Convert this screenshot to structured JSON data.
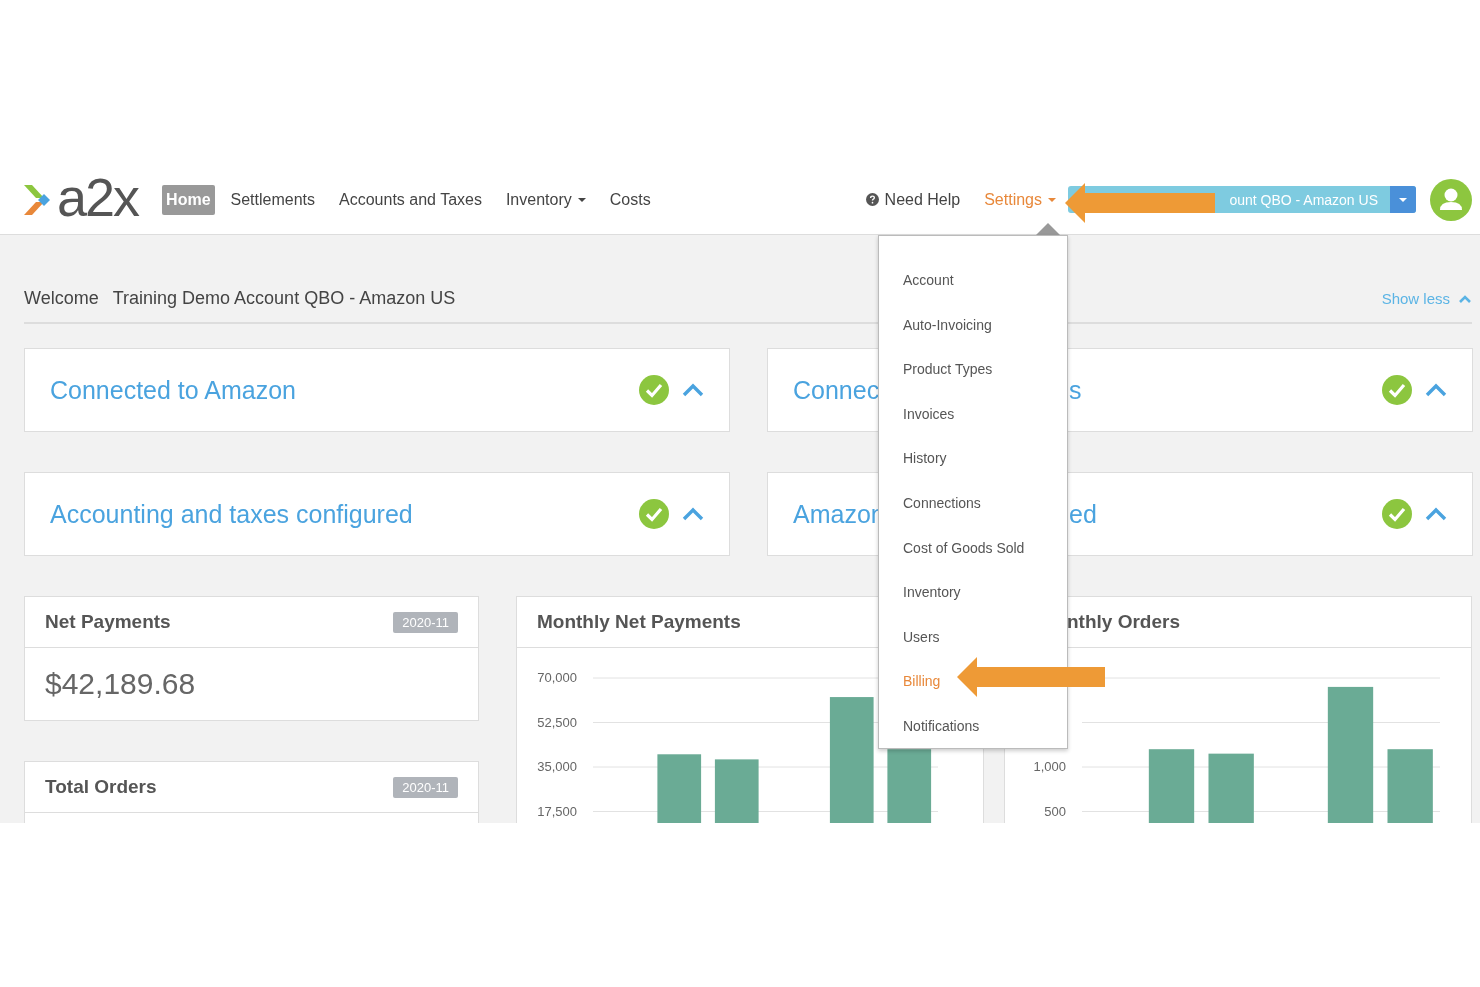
{
  "logo": {
    "text": "a2x"
  },
  "nav": [
    {
      "label": "Home",
      "selected": true,
      "dropdown": false
    },
    {
      "label": "Settlements",
      "selected": false,
      "dropdown": false
    },
    {
      "label": "Accounts and Taxes",
      "selected": false,
      "dropdown": false
    },
    {
      "label": "Inventory",
      "selected": false,
      "dropdown": true
    },
    {
      "label": "Costs",
      "selected": false,
      "dropdown": false
    }
  ],
  "help": {
    "label": "Need Help"
  },
  "settings": {
    "label": "Settings",
    "open": true
  },
  "account_switcher": {
    "label": "ount QBO - Amazon US"
  },
  "welcome": {
    "label": "Welcome",
    "account": "Training Demo Account QBO - Amazon US",
    "toggle": "Show less"
  },
  "status_cards": [
    {
      "title": "Connected to Amazon",
      "done": true,
      "expanded": true
    },
    {
      "title": "Connec",
      "title_after_menu": "s",
      "done": true,
      "expanded": true
    },
    {
      "title": "Accounting and taxes configured",
      "done": true,
      "expanded": true
    },
    {
      "title": "Amazon",
      "title_after_menu": "ed",
      "done": true,
      "expanded": true
    }
  ],
  "stats": [
    {
      "title": "Net Payments",
      "period": "2020-11",
      "value": "$42,189.68"
    },
    {
      "title": "Total Orders",
      "period": "2020-11"
    }
  ],
  "charts": [
    {
      "title": "Monthly Net Payments",
      "chart_data": {
        "type": "bar",
        "values": [
          null,
          40000,
          38000,
          null,
          62500,
          42000
        ],
        "grid": true,
        "ylim": [
          0,
          70000
        ],
        "yticks": [
          {
            "value": 17500,
            "label": "17,500"
          },
          {
            "value": 35000,
            "label": "35,000"
          },
          {
            "value": 52500,
            "label": "52,500"
          },
          {
            "value": 70000,
            "label": "70,000"
          }
        ]
      }
    },
    {
      "title": "nthly Orders",
      "chart_data": {
        "type": "bar",
        "values": [
          null,
          1200,
          1150,
          null,
          1900,
          1200
        ],
        "grid": true,
        "ylim": [
          0,
          2000
        ],
        "yticks": [
          {
            "value": 500,
            "label": "500"
          },
          {
            "value": 1000,
            "label": "1,000"
          }
        ]
      }
    }
  ],
  "settings_menu": [
    {
      "label": "Account",
      "selected": false
    },
    {
      "label": "Auto-Invoicing",
      "selected": false
    },
    {
      "label": "Product Types",
      "selected": false
    },
    {
      "label": "Invoices",
      "selected": false
    },
    {
      "label": "History",
      "selected": false
    },
    {
      "label": "Connections",
      "selected": false
    },
    {
      "label": "Cost of Goods Sold",
      "selected": false
    },
    {
      "label": "Inventory",
      "selected": false
    },
    {
      "label": "Users",
      "selected": false
    },
    {
      "label": "Billing",
      "selected": true
    },
    {
      "label": "Notifications",
      "selected": false
    }
  ]
}
